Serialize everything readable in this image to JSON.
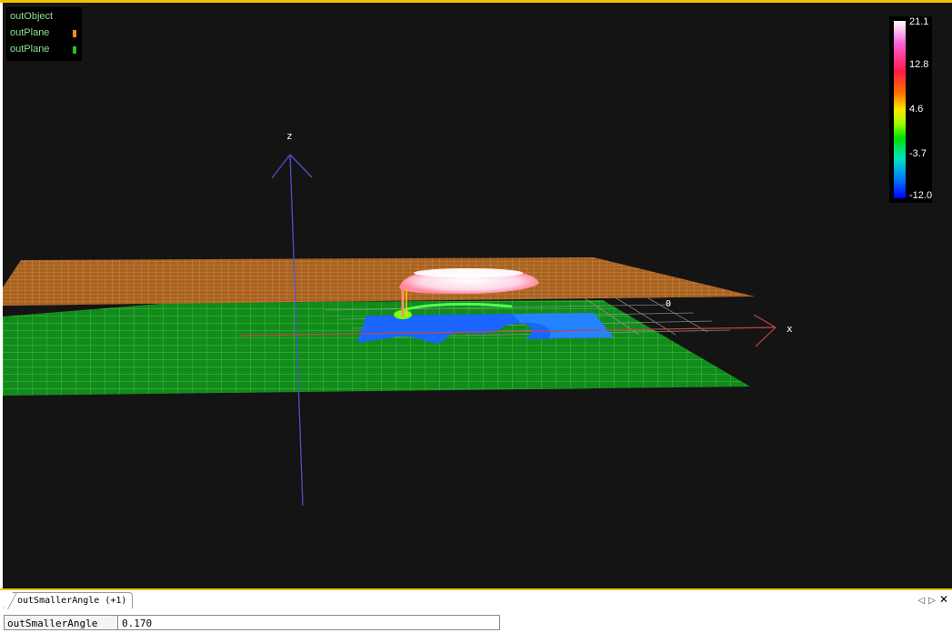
{
  "legend": {
    "items": [
      {
        "label": "outObject",
        "swatch": null
      },
      {
        "label": "outPlane",
        "swatch": "#ff8c1a"
      },
      {
        "label": "outPlane",
        "swatch": "#22c022"
      }
    ]
  },
  "axes": {
    "z_label": "z",
    "x_label": "x",
    "origin_label": "0"
  },
  "colorbar": {
    "labels": [
      "21.1",
      "12.8",
      "4.6",
      "-3.7",
      "-12.0"
    ]
  },
  "colors": {
    "orange_plane": "#c87830",
    "green_plane": "#1fa02a",
    "accent": "#f2c200"
  },
  "bottom_panel": {
    "tab_label": "outSmallerAngle (+1)",
    "field_label": "outSmallerAngle",
    "field_value": "0.170"
  }
}
